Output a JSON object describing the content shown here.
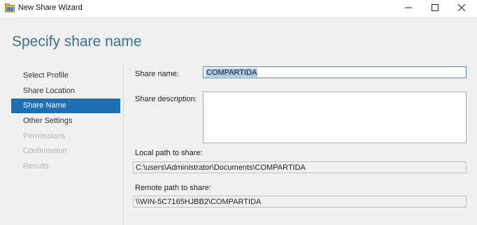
{
  "window": {
    "title": "New Share Wizard",
    "icon": "share-folder-icon",
    "controls": [
      "minimize-icon",
      "maximize-icon",
      "close-icon"
    ]
  },
  "page": {
    "title": "Specify share name"
  },
  "nav": {
    "items": [
      {
        "label": "Select Profile",
        "state": "normal"
      },
      {
        "label": "Share Location",
        "state": "normal"
      },
      {
        "label": "Share Name",
        "state": "selected"
      },
      {
        "label": "Other Settings",
        "state": "normal"
      },
      {
        "label": "Permissions",
        "state": "disabled"
      },
      {
        "label": "Confirmation",
        "state": "disabled"
      },
      {
        "label": "Results",
        "state": "disabled"
      }
    ]
  },
  "form": {
    "share_name_label": "Share name:",
    "share_name_value": "COMPARTIDA",
    "share_description_label": "Share description:",
    "share_description_value": "",
    "local_path_label": "Local path to share:",
    "local_path_value": "C:\\users\\Administrator\\Documents\\COMPARTIDA",
    "remote_path_label": "Remote path to share:",
    "remote_path_value": "\\\\WIN-5C7165HJBB2\\COMPARTIDA"
  },
  "colors": {
    "accent": "#1e6fb4",
    "title": "#3b6e8c",
    "pane_background": "#f0f0f0",
    "disabled_text": "#b5b5b5"
  }
}
